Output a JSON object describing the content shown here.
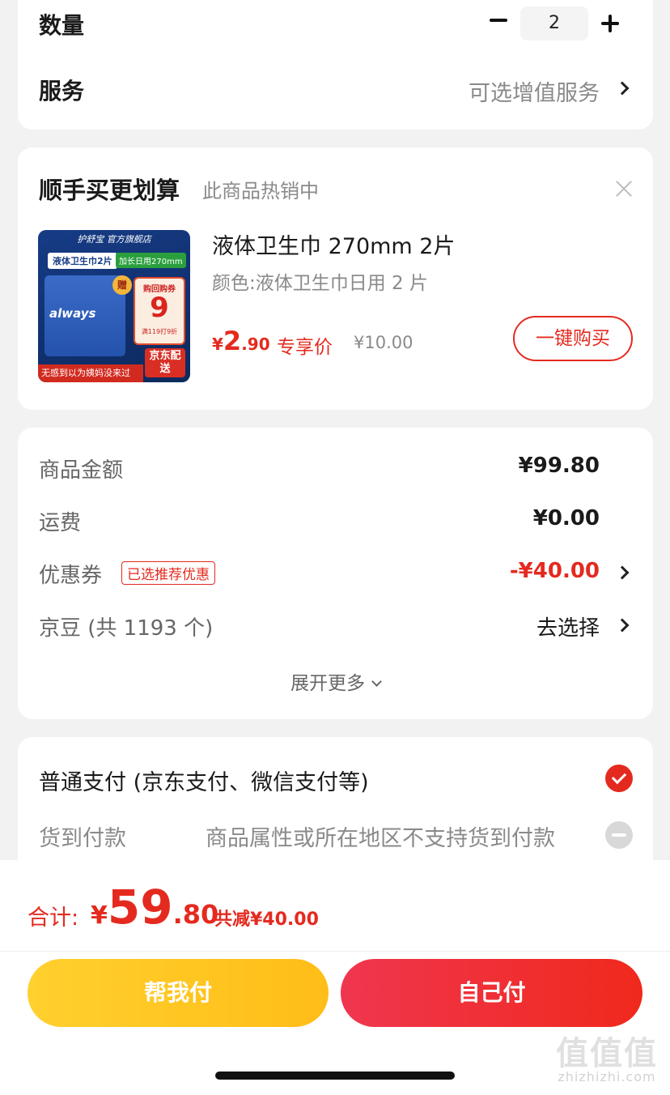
{
  "order": {
    "quantity_label": "数量",
    "quantity_value": "2",
    "service_label": "服务",
    "service_value": "可选增值服务"
  },
  "addon": {
    "title": "顺手买更划算",
    "subtitle": "此商品热销中",
    "product": {
      "name": "液体卫生巾 270mm 2片",
      "spec": "颜色:液体卫生巾日用 2 片",
      "price_symbol": "¥",
      "price_int": "2",
      "price_dec": ".90",
      "price_tag": "专享价",
      "original_price": "¥10.00",
      "buy_button": "一键购买",
      "image": {
        "brand": "护舒宝 官方旗舰店",
        "name": "液体卫生巾2片",
        "length": "加长日用270mm",
        "logo": "always",
        "gift": "赠",
        "coupon_title": "购回购券",
        "coupon_number": "9",
        "coupon_sub": "满119打9折",
        "jd_delivery": "京东配送",
        "slogan": "无感到以为姨妈没来过"
      }
    }
  },
  "summary": {
    "goods_amount_label": "商品金额",
    "goods_amount": "¥99.80",
    "shipping_label": "运费",
    "shipping": "¥0.00",
    "coupon_label": "优惠券",
    "coupon_badge": "已选推荐优惠",
    "coupon_amount": "-¥40.00",
    "beans_label": "京豆 (共 1193 个)",
    "beans_action": "去选择",
    "expand_more": "展开更多"
  },
  "payment": {
    "normal_label": "普通支付 (京东支付、微信支付等)",
    "cod_label": "货到付款",
    "cod_note": "商品属性或所在地区不支持货到付款"
  },
  "bottom": {
    "total_label": "合计:",
    "total_symbol": "¥",
    "total_int": "59",
    "total_dec": ".80",
    "discount": "共减¥40.00",
    "help_pay": "帮我付",
    "self_pay": "自己付"
  },
  "watermark": {
    "logo": "值值值",
    "url": "zhizhizhi.com"
  },
  "colors": {
    "accent_red": "#e42a1f",
    "help_yellow": "#ffc21f",
    "background": "#f2f2f2"
  }
}
